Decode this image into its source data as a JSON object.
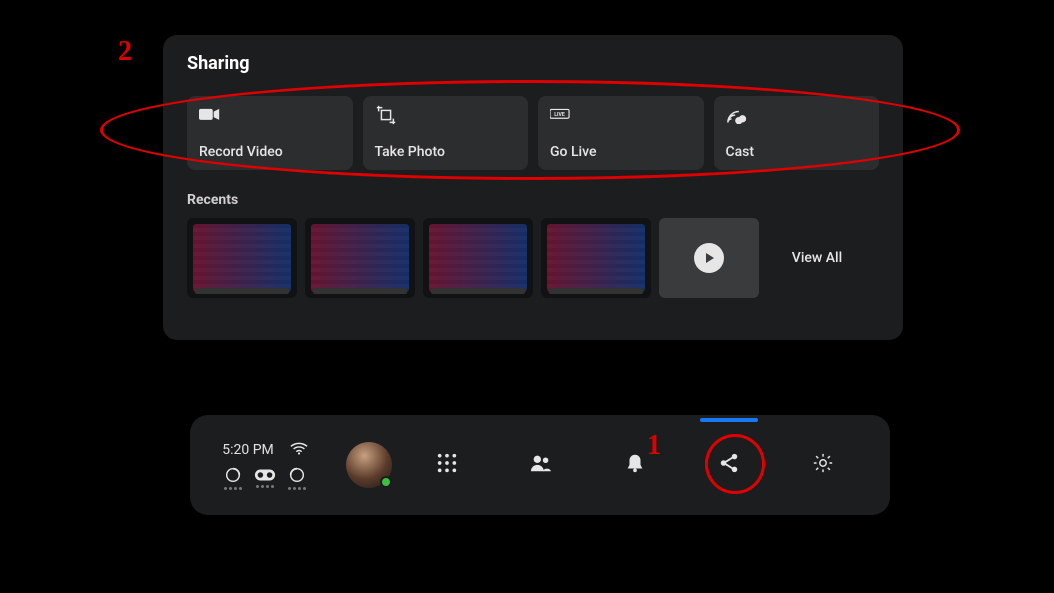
{
  "panel": {
    "title": "Sharing",
    "tiles": [
      {
        "label": "Record Video",
        "icon": "record-video-icon"
      },
      {
        "label": "Take Photo",
        "icon": "camera-crop-icon"
      },
      {
        "label": "Go Live",
        "icon": "live-badge-icon"
      },
      {
        "label": "Cast",
        "icon": "cast-icon"
      }
    ],
    "recents_title": "Recents",
    "recents_count": 4,
    "view_all_label": "View All"
  },
  "dock": {
    "time": "5:20 PM",
    "nav": {
      "apps": "apps",
      "people": "people",
      "notifications": "notifications",
      "share": "share",
      "settings": "settings"
    },
    "active_nav": "share"
  },
  "annotations": {
    "num1": "1",
    "num2": "2"
  }
}
